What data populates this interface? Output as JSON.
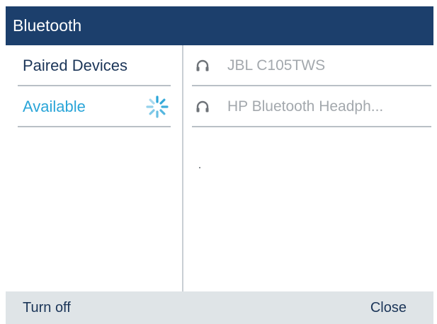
{
  "header": {
    "title": "Bluetooth",
    "background_color": "#1c3f6c"
  },
  "sidebar": {
    "items": [
      {
        "label": "Paired Devices",
        "color": "#1b3558"
      },
      {
        "label": "Available",
        "color": "#2aa5d8",
        "selected": true,
        "icon": "spinner-icon"
      }
    ]
  },
  "devices": [
    {
      "name": "JBL C105TWS",
      "icon": "headset-icon"
    },
    {
      "name": "HP Bluetooth Headph...",
      "icon": "headset-icon"
    }
  ],
  "softkeys": {
    "left_label": "Turn off",
    "right_label": "Close",
    "background_color": "#dfe4e7"
  }
}
